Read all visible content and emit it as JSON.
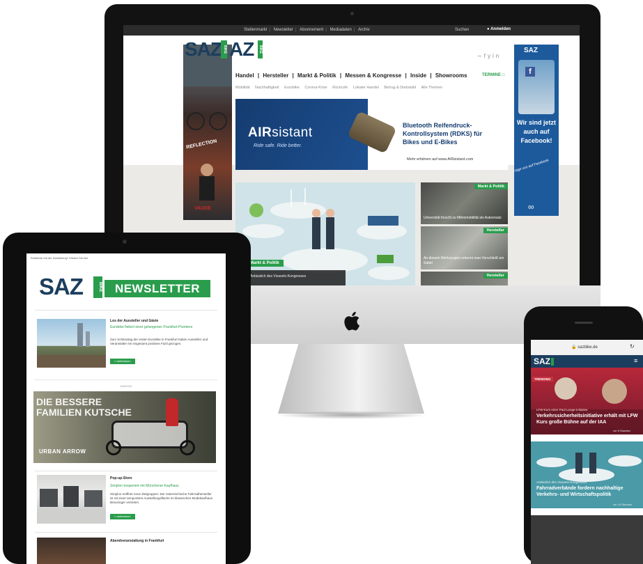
{
  "desktop": {
    "topnav": [
      "Stellenmarkt",
      "Newsletter",
      "Abonnement",
      "Mediadaten",
      "Archiv"
    ],
    "search_label": "Suchen",
    "login_label": "Anmelden",
    "logo_saz": "SAZ",
    "logo_az": "AZ",
    "logo_bike": "BIKE",
    "main_nav": [
      "Handel",
      "|",
      "Hersteller",
      "|",
      "Markt & Politik",
      "|",
      "Messen & Kongresse",
      "|",
      "Inside",
      "|",
      "Showrooms"
    ],
    "termine_label": "TERMINE",
    "sub_nav": [
      "Mobilität",
      "Nachhaltigkeit",
      "Eurobike",
      "Corona-Krise",
      "Rückrufe",
      "Lokaler Handel",
      "Betrug & Diebstahl",
      "Alle Themen"
    ],
    "left_ad": {
      "text": "REFLECTION",
      "brand": "VAUDE"
    },
    "right_ad": {
      "logo": "SAZ",
      "fb": "f",
      "text": "Wir sind jetzt auch auf Facebook!",
      "hand": "Folge uns auf Facebook"
    },
    "banner": {
      "brand_bold": "AIR",
      "brand_thin": "sistant",
      "tagline": "Ride safe. Ride better.",
      "headline": "Bluetooth Reifendruck-Kontrollsystem (RDKS) für Bikes und E-Bikes",
      "url": "Mehr erfahren auf www.AIRsistant.com"
    },
    "hero": {
      "badge": "Markt & Politik",
      "caption": "Anlässlich des Vivavelo-Kongresses"
    },
    "side_cards": [
      {
        "tag": "Markt & Politik",
        "caption": "Universität forscht zu Mikromobilität als Autoersatz"
      },
      {
        "tag": "Hersteller",
        "caption": "An diesem Werkzeugen erkennt man Verschleiß am Sattel"
      },
      {
        "tag": "Hersteller",
        "caption": ""
      }
    ]
  },
  "tablet": {
    "hint": "Probleme mit der Darstellung? Klicken Sie hier",
    "logo": "SAZ",
    "logo_bike": "BIKE",
    "newsletter": "NEWSLETTER",
    "items": [
      {
        "title": "Los der Aussteller und Gäste",
        "sub": "Eurobike fiebert einer gelungenen Frankfurt-Premiere",
        "body": "Zum Schlusstag der ersten Eurobike in Frankfurt haben Aussteller und Veranstalter ein insgesamt positives Fazit gezogen.",
        "button": "» weiterlesen"
      },
      {
        "title": "Pop-up-Store",
        "sub": "Simplon kooperiert mit Münchener Kaufhaus",
        "body": "Simplon eröffnet neue Zielgruppen: Der österreichische Fahrradhersteller ist mit einer temporären Ausstellungsfläche im klassischen Modekaufhaus Breuninger vertreten.",
        "button": "» weiterlesen"
      },
      {
        "title": "Abendveranstaltung in Frankfurt",
        "sub": "",
        "body": "",
        "button": ""
      }
    ],
    "ad_label": "ANZEIGE",
    "ad_text": "DIE BESSERE FAMILIEN KUTSCHE",
    "ad_brand": "URBAN ARROW"
  },
  "phone": {
    "url": "sazbike.de",
    "logo": "SAZ",
    "menu": "≡",
    "trending": "TRENDING",
    "card1": {
      "kicker": "LFW-Kurs einer Paul Lange-Initiative",
      "title": "Verkehrssicherheitsinitiative erhält mit LFW Kurs große Bühne auf der IAA",
      "meta": "vor 5 Stunden"
    },
    "card2": {
      "kicker": "Anlässlich des Vivavelo-Kongresses",
      "title": "Fahrradverbände fordern nachhaltige Verkehrs- und Wirtschaftspolitik",
      "meta": "vor 10 Stunden"
    }
  },
  "colors": {
    "accent_green": "#2a9d4c",
    "brand_navy": "#1c3e5e",
    "facebook_blue": "#1d5a9c"
  }
}
